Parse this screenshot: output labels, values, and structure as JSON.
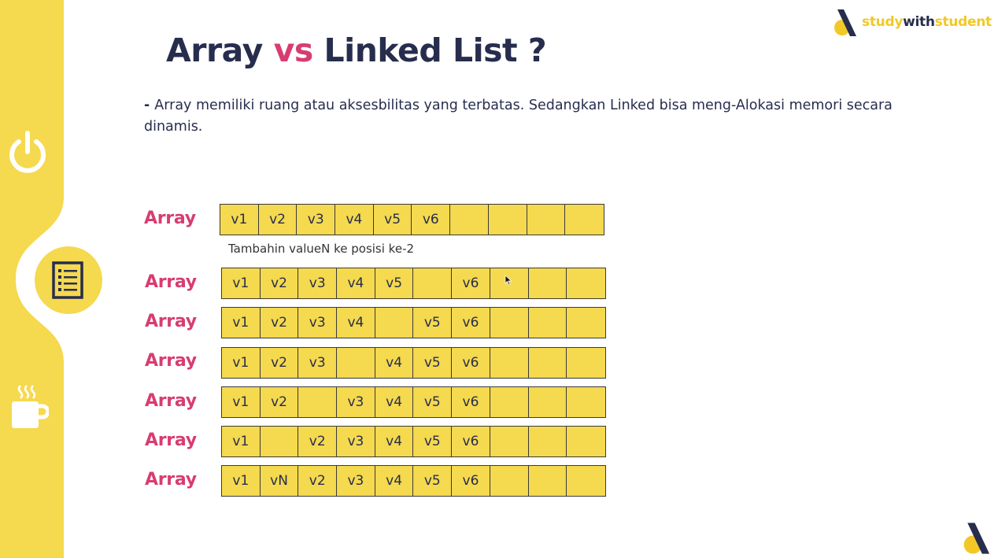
{
  "slide": {
    "title_part1": "Array",
    "title_vs": "vs",
    "title_part2": "Linked List ?",
    "brand": {
      "part1": "study",
      "part2": "with",
      "part3": "student"
    },
    "description_dash": "-",
    "description": "Array memiliki ruang atau aksesbilitas yang terbatas. Sedangkan Linked bisa meng-Alokasi memori secara dinamis.",
    "note": "Tambahin valueN ke posisi ke-2",
    "arrays": [
      {
        "label": "Array",
        "cells": [
          "v1",
          "v2",
          "v3",
          "v4",
          "v5",
          "v6",
          "",
          "",
          "",
          ""
        ]
      },
      {
        "label": "Array",
        "cells": [
          "v1",
          "v2",
          "v3",
          "v4",
          "v5",
          "",
          "v6",
          "",
          "",
          ""
        ]
      },
      {
        "label": "Array",
        "cells": [
          "v1",
          "v2",
          "v3",
          "v4",
          "",
          "v5",
          "v6",
          "",
          "",
          ""
        ]
      },
      {
        "label": "Array",
        "cells": [
          "v1",
          "v2",
          "v3",
          "",
          "v4",
          "v5",
          "v6",
          "",
          "",
          ""
        ]
      },
      {
        "label": "Array",
        "cells": [
          "v1",
          "v2",
          "",
          "v3",
          "v4",
          "v5",
          "v6",
          "",
          "",
          ""
        ]
      },
      {
        "label": "Array",
        "cells": [
          "v1",
          "",
          "v2",
          "v3",
          "v4",
          "v5",
          "v6",
          "",
          "",
          ""
        ]
      },
      {
        "label": "Array",
        "cells": [
          "v1",
          "vN",
          "v2",
          "v3",
          "v4",
          "v5",
          "v6",
          "",
          "",
          ""
        ]
      }
    ]
  },
  "sidebar": {
    "icons": [
      "power-icon",
      "list-icon",
      "coffee-mug-icon"
    ]
  },
  "colors": {
    "accent_yellow": "#f5d94e",
    "accent_pink": "#d83c72",
    "navy": "#272d4d"
  }
}
